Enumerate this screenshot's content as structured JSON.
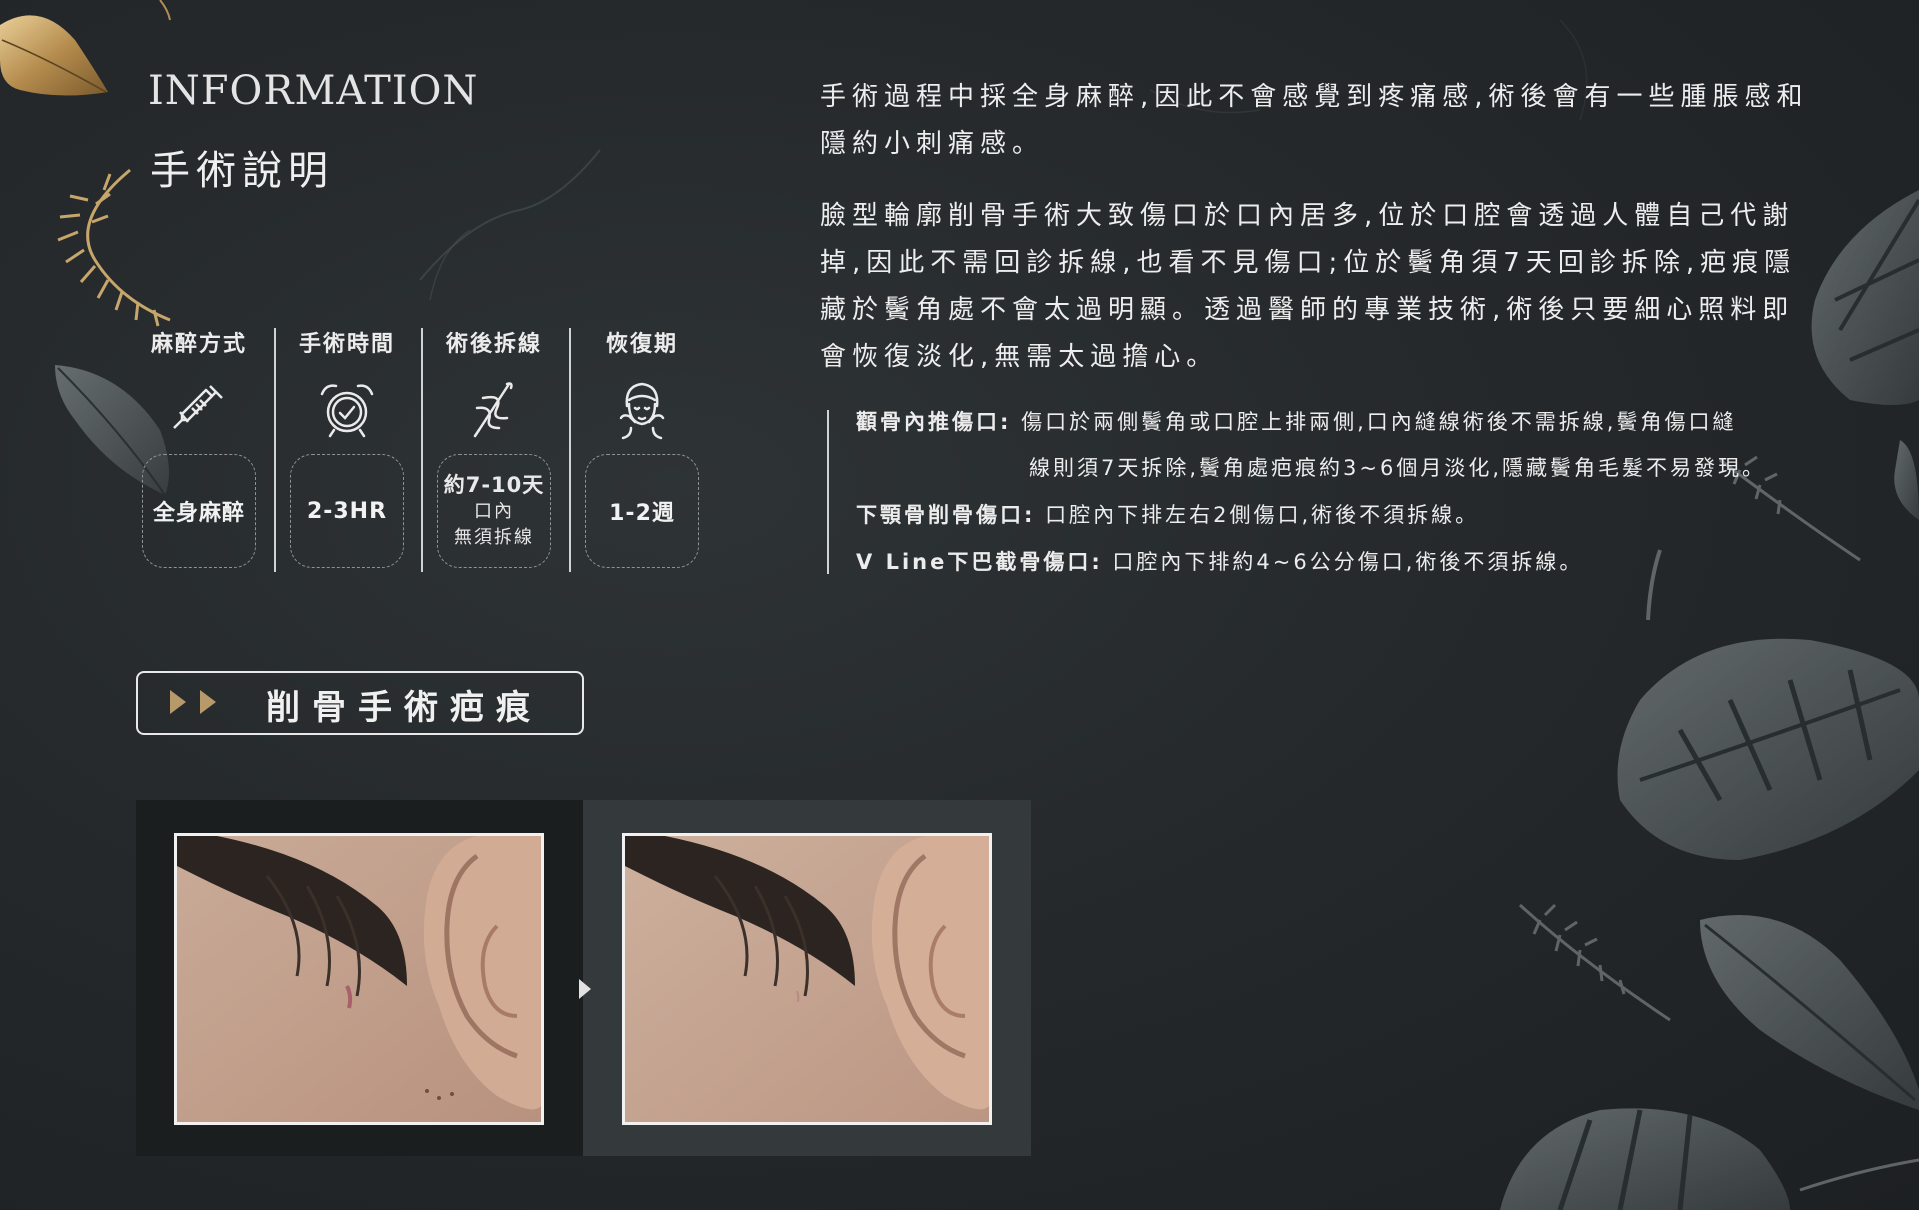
{
  "header": {
    "title_en": "INFORMATION",
    "title_zh": "手術說明"
  },
  "info_columns": [
    {
      "label": "麻醉方式",
      "icon": "syringe-icon",
      "value": "全身麻醉"
    },
    {
      "label": "手術時間",
      "icon": "alarm-clock-icon",
      "value": "2-3HR"
    },
    {
      "label": "術後拆線",
      "icon": "suture-needle-icon",
      "value_line1": "約7-10天",
      "value_line2": "口內",
      "value_line3": "無須拆線"
    },
    {
      "label": "恢復期",
      "icon": "face-recovery-icon",
      "value": "1-2週"
    }
  ],
  "description": {
    "paragraph1": "手術過程中採全身麻醉,因此不會感覺到疼痛感,術後會有一些腫脹感和隱約小刺痛感。",
    "paragraph2": "臉型輪廓削骨手術大致傷口於口內居多,位於口腔會透過人體自己代謝掉,因此不需回診拆線,也看不見傷口;位於鬢角須7天回診拆除,疤痕隱藏於鬢角處不會太過明顯。透過醫師的專業技術,術後只要細心照料即會恢復淡化,無需太過擔心。"
  },
  "details": [
    {
      "label": "顴骨內推傷口:",
      "text": "傷口於兩側鬢角或口腔上排兩側,口內縫線術後不需拆線,鬢角傷口縫",
      "continuation": "線則須7天拆除,鬢角處疤痕約3~6個月淡化,隱藏鬢角毛髮不易發現。"
    },
    {
      "label": "下顎骨削骨傷口:",
      "text": "口腔內下排左右2側傷口,術後不須拆線。"
    },
    {
      "label": "V Line下巴截骨傷口:",
      "text": "口腔內下排約4~6公分傷口,術後不須拆線。"
    }
  ],
  "section_tag": {
    "label": "削骨手術疤痕",
    "icon": "double-play-arrow-icon"
  },
  "photos": {
    "before_icon": "ear-before-photo",
    "after_icon": "ear-after-photo",
    "arrow_icon": "right-triangle-arrow-icon"
  },
  "colors": {
    "background": "#25292b",
    "text": "#ececec",
    "gold": "#c8a46a",
    "tag_arrow": "#b89a6a"
  }
}
